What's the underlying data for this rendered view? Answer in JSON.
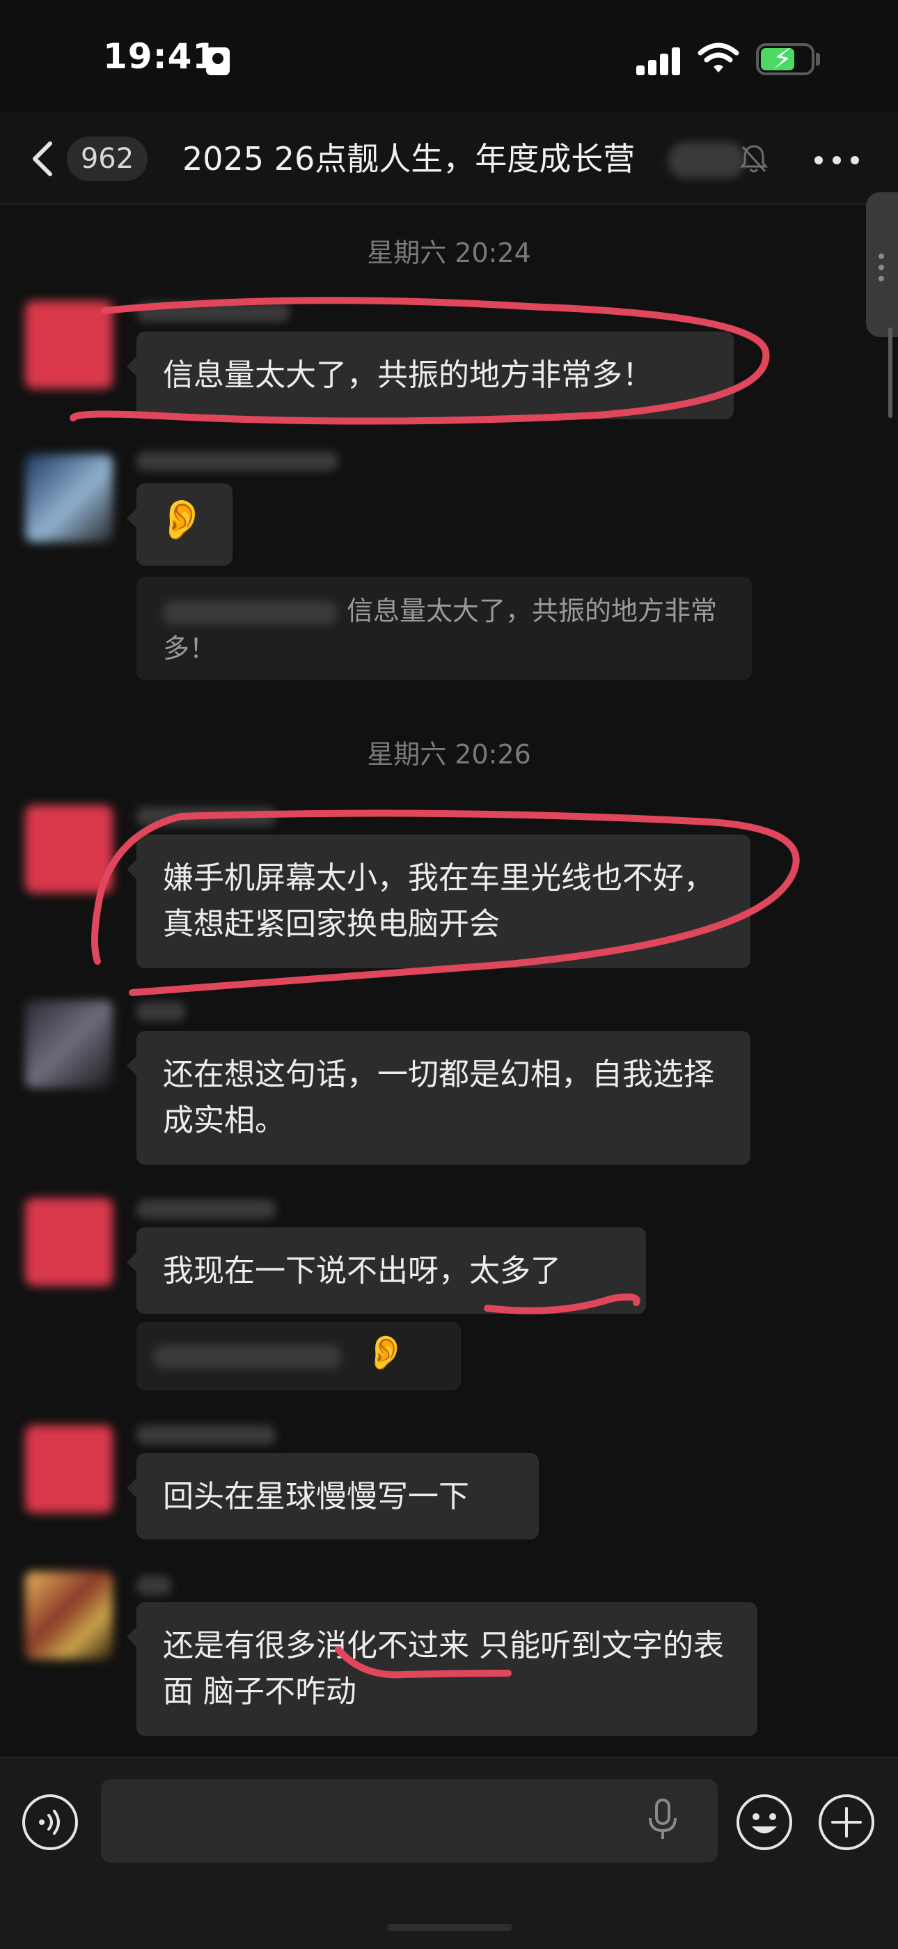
{
  "status_bar": {
    "time": "19:41",
    "icons": [
      "id-card-icon",
      "cellular-signal-icon",
      "wifi-icon",
      "battery-charging-icon"
    ],
    "battery_level": 0.65,
    "battery_color": "#4cd964"
  },
  "nav": {
    "unread_count": "962",
    "title": "2025 26点靓人生，年度成长营",
    "icons": [
      "back-chevron-icon",
      "mute-bell-icon",
      "more-icon"
    ]
  },
  "messages": {
    "ts1": "星期六 20:24",
    "m1": "信息量太大了，共振的地方非常多！",
    "m2_emoji": "👂",
    "m2_quote": "信息量太大了，共振的地方非常多！",
    "ts2": "星期六 20:26",
    "m3": "嫌手机屏幕太小，我在车里光线也不好，真想赶紧回家换电脑开会",
    "m4": "还在想这句话，一切都是幻相，自我选择成实相。",
    "m5": "我现在一下说不出呀，太多了",
    "m5_reaction": "👂",
    "m6": "回头在星球慢慢写一下",
    "m7": "还是有很多消化不过来 只能听到文字的表面 脑子不咋动"
  },
  "input_bar": {
    "placeholder": "",
    "icons": [
      "voice-mode-icon",
      "microphone-icon",
      "emoji-icon",
      "plus-icon"
    ]
  },
  "colors": {
    "background": "#111111",
    "bubble": "#2c2c2c",
    "annotation": "#e0475d",
    "timestamp": "#7a7a7a"
  }
}
